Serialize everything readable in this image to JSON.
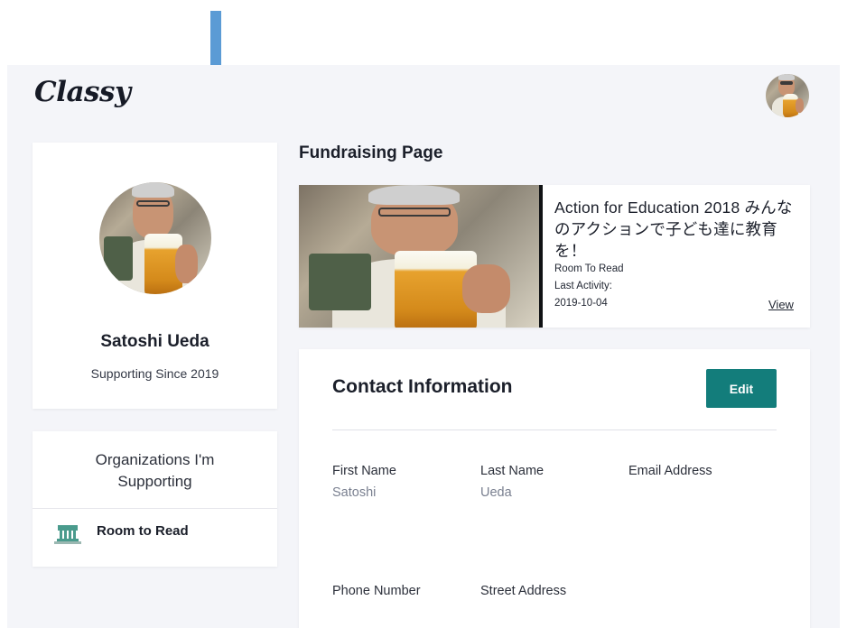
{
  "app": {
    "logo": "Classy"
  },
  "profile": {
    "name": "Satoshi Ueda",
    "since": "Supporting Since 2019"
  },
  "organizations": {
    "title": "Organizations I'm Supporting",
    "items": [
      {
        "name": "Room to Read"
      }
    ]
  },
  "fundraising": {
    "section_title": "Fundraising Page",
    "page_title": "Action for Education 2018 みんなのアクションで子ども達に教育を！",
    "organization": "Room To Read",
    "last_activity_label": "Last Activity:",
    "last_activity_date": "2019-10-04",
    "view_label": "View"
  },
  "contact": {
    "title": "Contact Information",
    "edit_label": "Edit",
    "fields": {
      "first_name": {
        "label": "First Name",
        "value": "Satoshi"
      },
      "last_name": {
        "label": "Last Name",
        "value": "Ueda"
      },
      "email": {
        "label": "Email Address",
        "value": ""
      },
      "phone": {
        "label": "Phone Number",
        "value": ""
      },
      "street": {
        "label": "Street Address",
        "value": ""
      }
    }
  },
  "icons": {
    "annotation": "down-arrow-icon",
    "user_avatar": "user-avatar",
    "org_logo": "room-to-read-logo-icon"
  },
  "colors": {
    "accent": "#137d7b",
    "annotation_arrow": "#5b9bd5",
    "page_background": "#f4f5f9"
  }
}
